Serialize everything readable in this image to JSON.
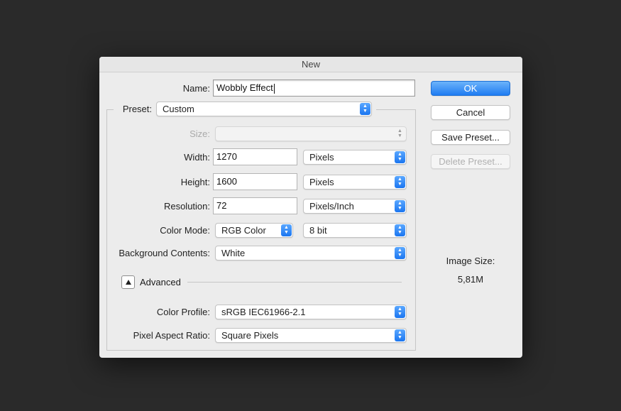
{
  "dialog": {
    "title": "New"
  },
  "form": {
    "name": {
      "label": "Name:",
      "value": "Wobbly Effect"
    },
    "preset": {
      "label": "Preset:",
      "value": "Custom"
    },
    "size": {
      "label": "Size:",
      "value": ""
    },
    "width": {
      "label": "Width:",
      "value": "1270",
      "unit": "Pixels"
    },
    "height": {
      "label": "Height:",
      "value": "1600",
      "unit": "Pixels"
    },
    "resolution": {
      "label": "Resolution:",
      "value": "72",
      "unit": "Pixels/Inch"
    },
    "color_mode": {
      "label": "Color Mode:",
      "value": "RGB Color",
      "depth": "8 bit"
    },
    "background": {
      "label": "Background Contents:",
      "value": "White"
    },
    "advanced": {
      "label": "Advanced"
    },
    "color_profile": {
      "label": "Color Profile:",
      "value": "sRGB IEC61966-2.1"
    },
    "pixel_aspect": {
      "label": "Pixel Aspect Ratio:",
      "value": "Square Pixels"
    }
  },
  "buttons": {
    "ok": "OK",
    "cancel": "Cancel",
    "save_preset": "Save Preset...",
    "delete_preset": "Delete Preset..."
  },
  "image_size": {
    "label": "Image Size:",
    "value": "5,81M"
  },
  "colors": {
    "accent": "#1f7cf2",
    "background": "#2a2a2a",
    "dialog": "#ececec"
  }
}
